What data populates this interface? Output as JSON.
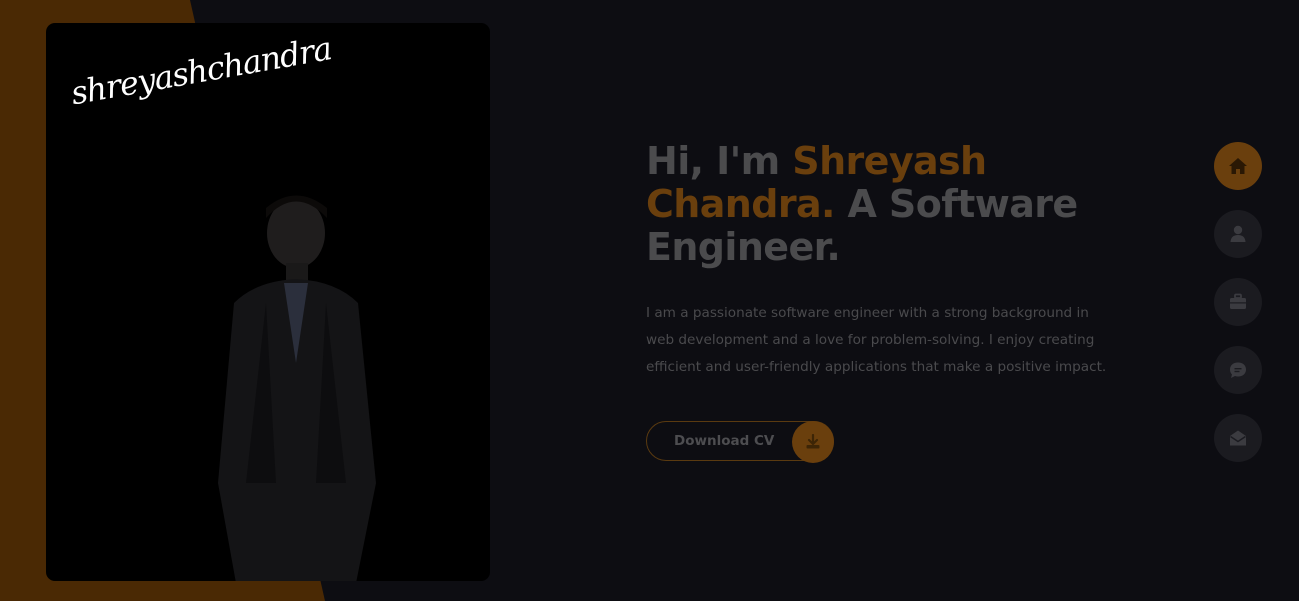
{
  "colors": {
    "accent": "#6a3f0d",
    "background": "#0d0d12",
    "card": "#000000",
    "muted_text": "#4b4b4d",
    "nav_button": "#1b1b20"
  },
  "signature": {
    "text": "shreyashchandra"
  },
  "hero": {
    "greeting": "Hi, I'm ",
    "name": "Shreyash Chandra.",
    "role": " A Software Engineer.",
    "intro": "I am a passionate software engineer with a strong background in web development and a love for problem-solving. I enjoy creating efficient and user-friendly applications that make a positive impact.",
    "cv_button_label": "Download CV",
    "cv_icon": "download-icon"
  },
  "side_nav": {
    "items": [
      {
        "icon": "home-icon",
        "active": true
      },
      {
        "icon": "user-icon",
        "active": false
      },
      {
        "icon": "briefcase-icon",
        "active": false
      },
      {
        "icon": "chat-icon",
        "active": false
      },
      {
        "icon": "mail-icon",
        "active": false
      }
    ]
  }
}
